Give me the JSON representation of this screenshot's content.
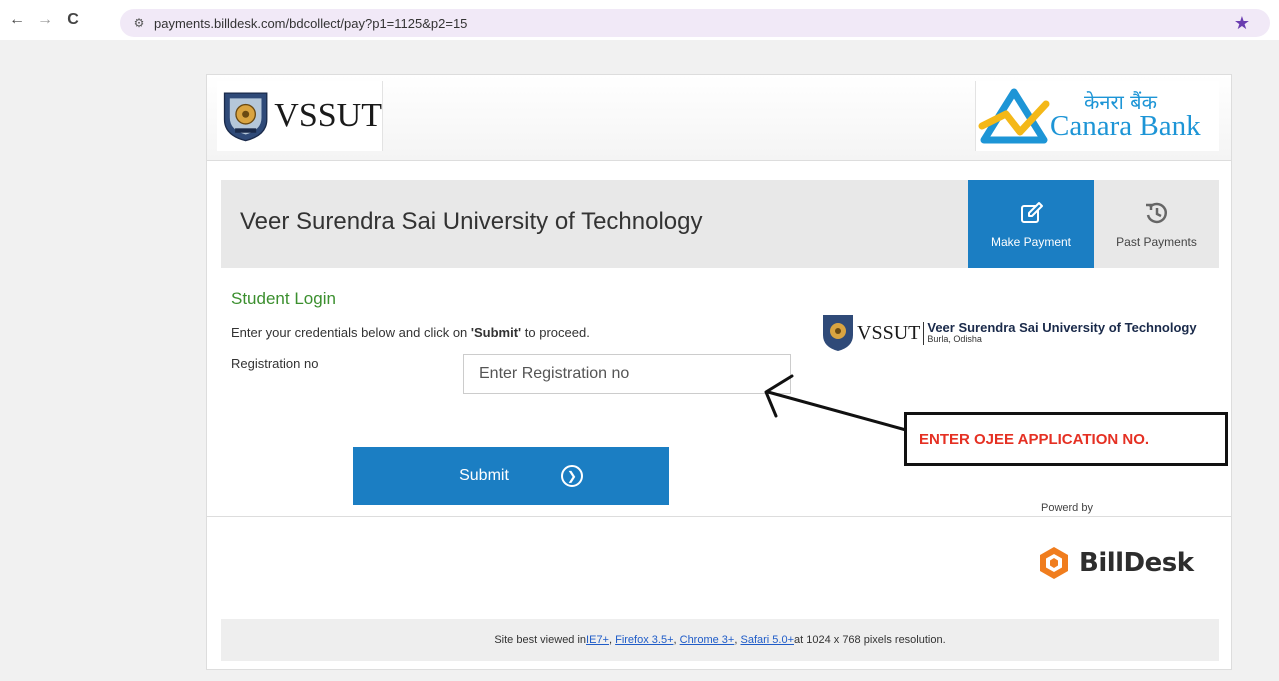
{
  "browser": {
    "url": "payments.billdesk.com/bdcollect/pay?p1=1125&p2=15",
    "back": "←",
    "forward": "→",
    "reload": "C",
    "star": "★"
  },
  "header": {
    "left_logo_text": "VSSUT",
    "right_logo_hindi": "केनरा बैंक",
    "right_logo_text": "Canara Bank"
  },
  "title_bar": {
    "university_name": "Veer Surendra Sai University of Technology",
    "tabs": [
      {
        "label": "Make Payment",
        "icon": "edit-icon",
        "active": true
      },
      {
        "label": "Past Payments",
        "icon": "history-icon",
        "active": false
      }
    ]
  },
  "login": {
    "heading": "Student Login",
    "instruction_before": "Enter your credentials below and click on ",
    "instruction_bold": "'Submit'",
    "instruction_after": " to proceed.",
    "reg_label": "Registration no",
    "reg_placeholder": "Enter Registration no",
    "submit_label": "Submit"
  },
  "side_logo": {
    "short": "VSSUT",
    "name": "Veer Surendra Sai University of Technology",
    "location": "Burla, Odisha"
  },
  "powered": {
    "label": "Powerd by",
    "brand": "BillDesk"
  },
  "footer": {
    "prefix": "Site best viewed in ",
    "links": [
      "IE7+",
      "Firefox 3.5+",
      "Chrome 3+",
      "Safari 5.0+"
    ],
    "suffix": " at 1024 x 768 pixels resolution."
  },
  "annotation": {
    "text": "ENTER OJEE APPLICATION NO."
  },
  "colors": {
    "primary_blue": "#1b7ec3",
    "heading_green": "#3b8f2e",
    "annotation_red": "#e53023",
    "billdesk_orange": "#f07d1e"
  }
}
